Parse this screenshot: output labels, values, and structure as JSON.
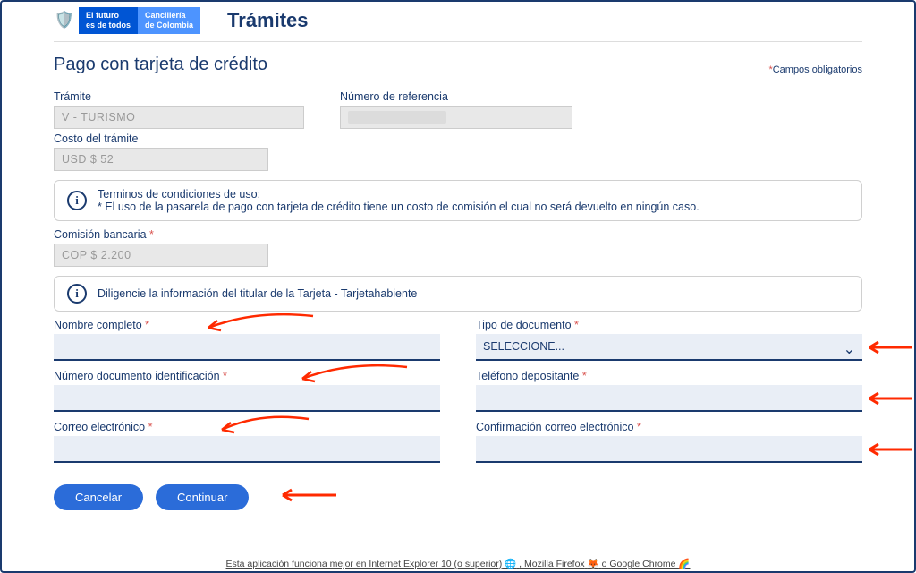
{
  "header": {
    "logo_line1": "El futuro",
    "logo_line2": "es de todos",
    "logo2_line1": "Cancillería",
    "logo2_line2": "de Colombia",
    "title": "Trámites"
  },
  "page_title": "Pago con tarjeta de crédito",
  "required_note": "Campos obligatorios",
  "fields": {
    "tramite_label": "Trámite",
    "tramite_value": "V - TURISMO",
    "numero_ref_label": "Número de referencia",
    "costo_label": "Costo del trámite",
    "costo_value": "USD  $ 52",
    "comision_label": "Comisión bancaria",
    "comision_value": "COP  $ 2.200"
  },
  "terms": {
    "heading": "Terminos de condiciones de uso:",
    "body": "* El uso de la pasarela de pago con tarjeta de crédito tiene un costo de comisión el cual no será devuelto en ningún caso."
  },
  "instruction": "Diligencie la información del titular de la Tarjeta - Tarjetahabiente",
  "form": {
    "nombre_label": "Nombre completo",
    "tipo_doc_label": "Tipo de documento",
    "tipo_doc_selected": "SELECCIONE...",
    "num_doc_label": "Número documento identificación",
    "telefono_label": "Teléfono depositante",
    "correo_label": "Correo electrónico",
    "confirm_correo_label": "Confirmación correo electrónico"
  },
  "buttons": {
    "cancel": "Cancelar",
    "continue": "Continuar"
  },
  "footer": {
    "text1": "Esta aplicación funciona mejor en Internet Explorer 10 (o superior)",
    "text2": ", Mozilla Firefox",
    "text3": "o Google Chrome"
  }
}
